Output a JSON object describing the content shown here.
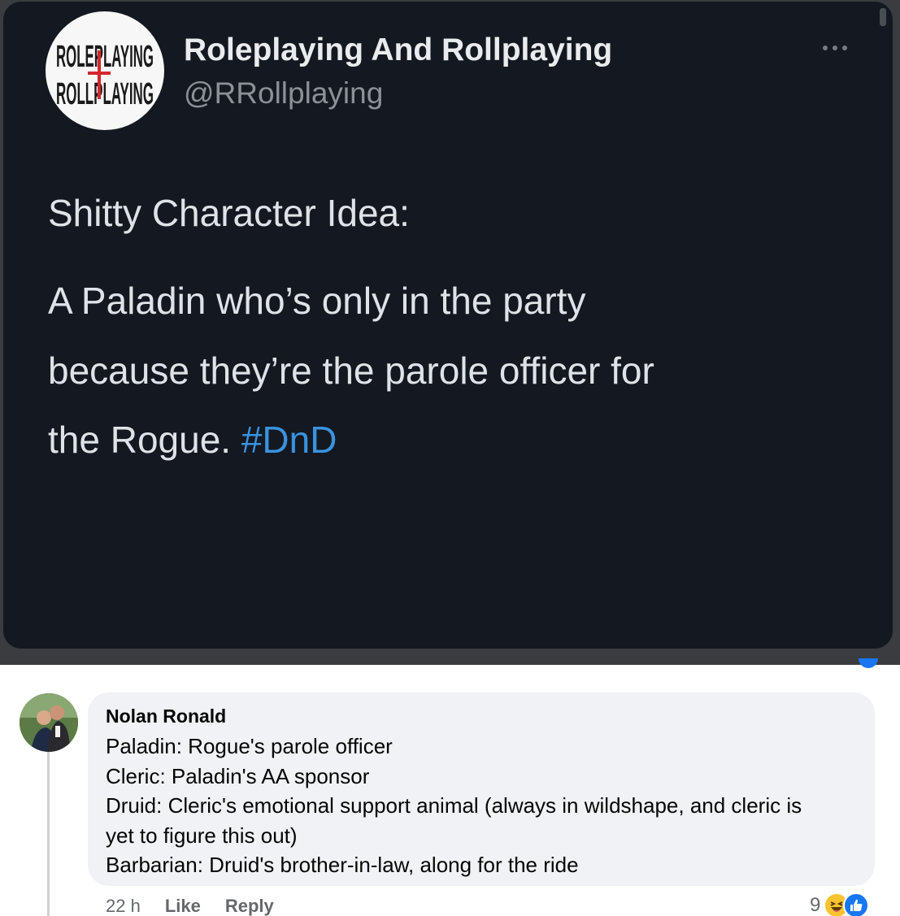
{
  "tweet": {
    "logo_text": "ROLEPLAYING ROLLPLAYING",
    "author_name": "Roleplaying And Rollplaying",
    "author_handle": "@RRollplaying",
    "heading": "Shitty Character Idea:",
    "body_lines": [
      "A Paladin who’s only in the party",
      "because they’re the parole officer for",
      "the Rogue. "
    ],
    "hashtag": "#DnD",
    "colors": {
      "background": "#141820",
      "hashtag": "#3a92df",
      "logo_accent": "#d4262c"
    }
  },
  "comment": {
    "author": "Nolan Ronald",
    "lines": [
      "Paladin: Rogue's parole officer",
      "Cleric: Paladin's AA sponsor",
      "Druid: Cleric's emotional support animal (always in wildshape, and cleric is",
      "yet to figure this out)",
      "Barbarian: Druid's brother-in-law, along for the ride"
    ],
    "time": "22 h",
    "like_label": "Like",
    "reply_label": "Reply",
    "reaction_count": "9",
    "reactions": [
      "haha-icon",
      "like-icon"
    ]
  }
}
